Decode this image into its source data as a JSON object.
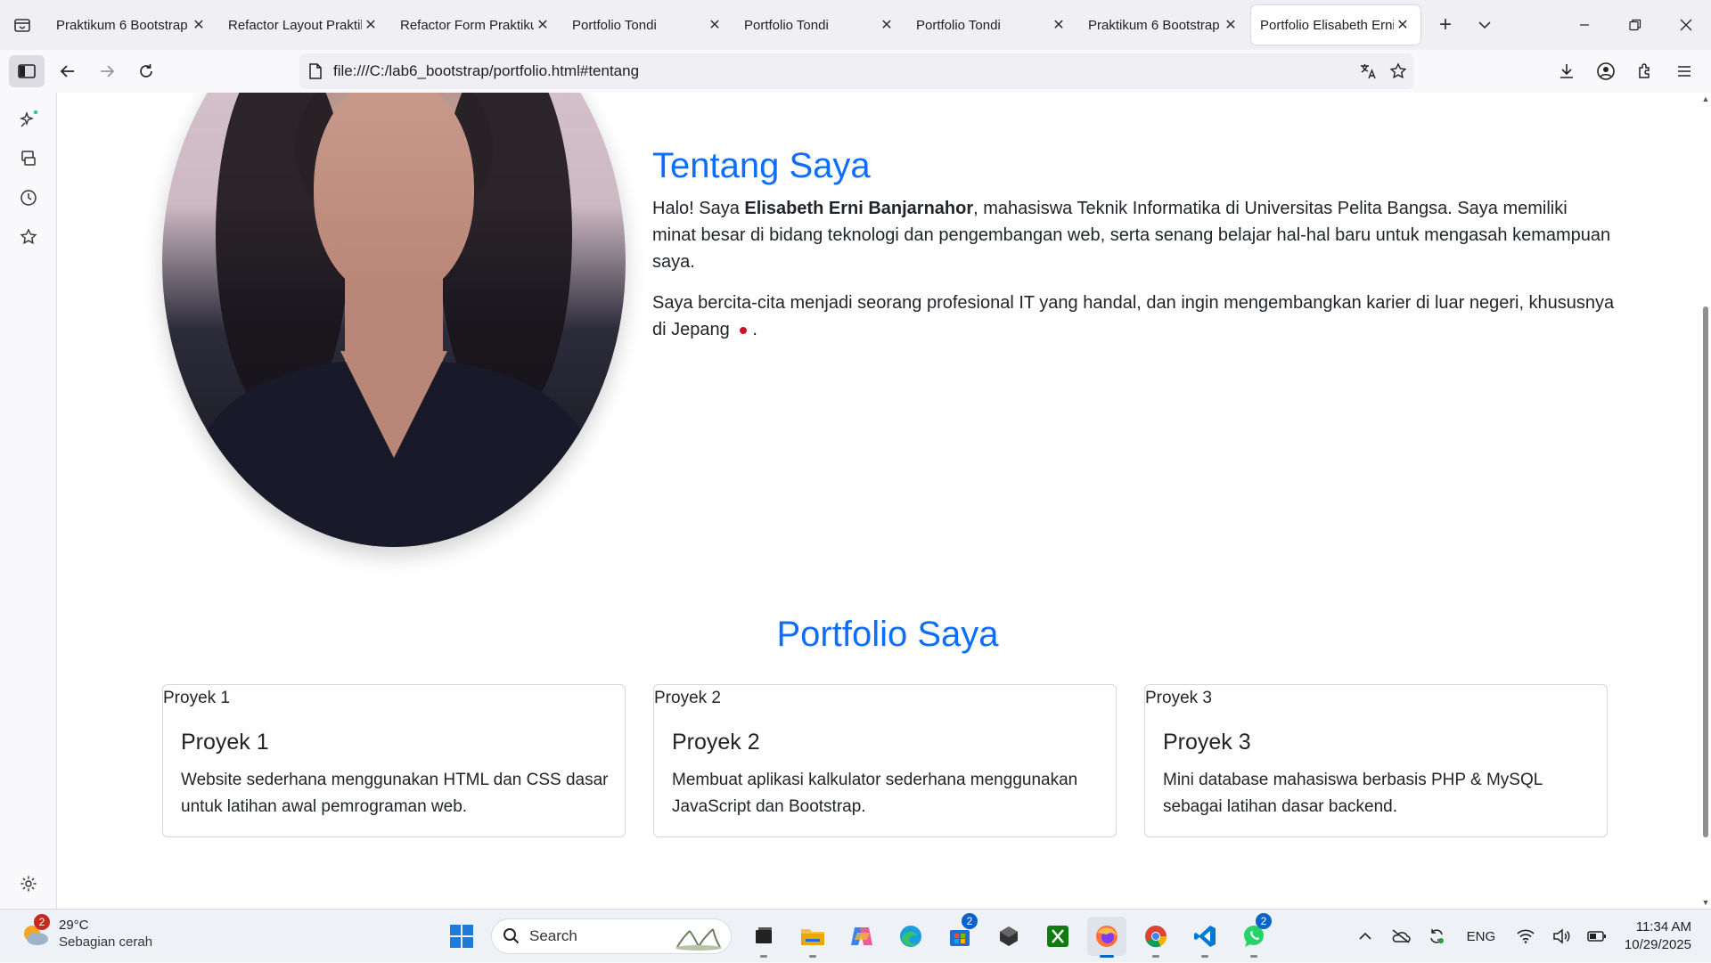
{
  "browser": {
    "tabs": [
      {
        "label": "Praktikum 6 Bootstrap",
        "active": false
      },
      {
        "label": "Refactor Layout Praktikum",
        "active": false
      },
      {
        "label": "Refactor Form Praktikum",
        "active": false
      },
      {
        "label": "Portfolio Tondi",
        "active": false
      },
      {
        "label": "Portfolio Tondi",
        "active": false
      },
      {
        "label": "Portfolio Tondi",
        "active": false
      },
      {
        "label": "Praktikum 6 Bootstrap",
        "active": false
      },
      {
        "label": "Portfolio Elisabeth Erni",
        "active": true
      }
    ],
    "url": "file:///C:/lab6_bootstrap/portfolio.html#tentang"
  },
  "page": {
    "about": {
      "heading": "Tentang Saya",
      "p1_prefix": "Halo! Saya ",
      "p1_name": "Elisabeth Erni Banjarnahor",
      "p1_suffix": ", mahasiswa Teknik Informatika di Universitas Pelita Bangsa. Saya memiliki minat besar di bidang teknologi dan pengembangan web, serta senang belajar hal-hal baru untuk mengasah kemampuan saya.",
      "p2_text": "Saya bercita-cita menjadi seorang profesional IT yang handal, dan ingin mengembangkan karier di luar negeri, khususnya di Jepang",
      "p2_end": "."
    },
    "portfolio": {
      "heading": "Portfolio Saya",
      "cards": [
        {
          "img_alt": "Proyek 1",
          "title": "Proyek 1",
          "text": "Website sederhana menggunakan HTML dan CSS dasar untuk latihan awal pemrograman web."
        },
        {
          "img_alt": "Proyek 2",
          "title": "Proyek 2",
          "text": "Membuat aplikasi kalkulator sederhana menggunakan JavaScript dan Bootstrap."
        },
        {
          "img_alt": "Proyek 3",
          "title": "Proyek 3",
          "text": "Mini database mahasiswa berbasis PHP & MySQL sebagai latihan dasar backend."
        }
      ]
    }
  },
  "taskbar": {
    "weather": {
      "temp": "29°C",
      "desc": "Sebagian cerah",
      "badge": "2"
    },
    "search_placeholder": "Search",
    "store_badge": "2",
    "whatsapp_badge": "2",
    "lang": "ENG",
    "time": "11:34 AM",
    "date": "10/29/2025"
  },
  "colors": {
    "accent": "#0d6efd",
    "taskbar": "#eef1f6"
  }
}
